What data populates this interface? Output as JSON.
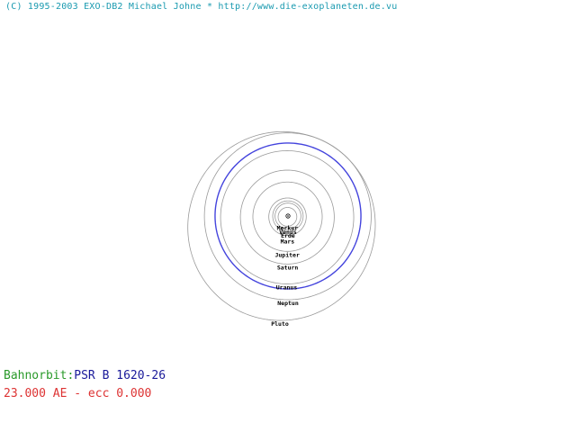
{
  "header": {
    "copyright": "(C) 1995-2003 EXO-DB2 Michael Johne * http://www.die-exoplaneten.de.vu"
  },
  "colors": {
    "orbit": "#9a9a9a",
    "exoplanet_orbit": "#4444dd",
    "label_green": "#2a9a2a",
    "label_blue": "#1a1a9a",
    "label_red": "#dd3333",
    "copyright": "#1a9ab0"
  },
  "planets": [
    {
      "name": "Merkur",
      "a": 0.387,
      "e": 0.206
    },
    {
      "name": "Venus",
      "a": 0.723,
      "e": 0.007
    },
    {
      "name": "Erde",
      "a": 1.0,
      "e": 0.017
    },
    {
      "name": "Mars",
      "a": 1.524,
      "e": 0.093
    },
    {
      "name": "Jupiter",
      "a": 5.203,
      "e": 0.048
    },
    {
      "name": "Saturn",
      "a": 9.537,
      "e": 0.054
    },
    {
      "name": "Uranus",
      "a": 19.191,
      "e": 0.047
    },
    {
      "name": "Neptun",
      "a": 30.069,
      "e": 0.009
    },
    {
      "name": "Pluto",
      "a": 39.482,
      "e": 0.249
    }
  ],
  "exoplanet": {
    "a": 23.0,
    "e": 0.0
  },
  "info": {
    "orbit_label": "Bahnorbit:",
    "system_name": "PSR B 1620-26",
    "params": "23.000 AE - ecc 0.000"
  }
}
